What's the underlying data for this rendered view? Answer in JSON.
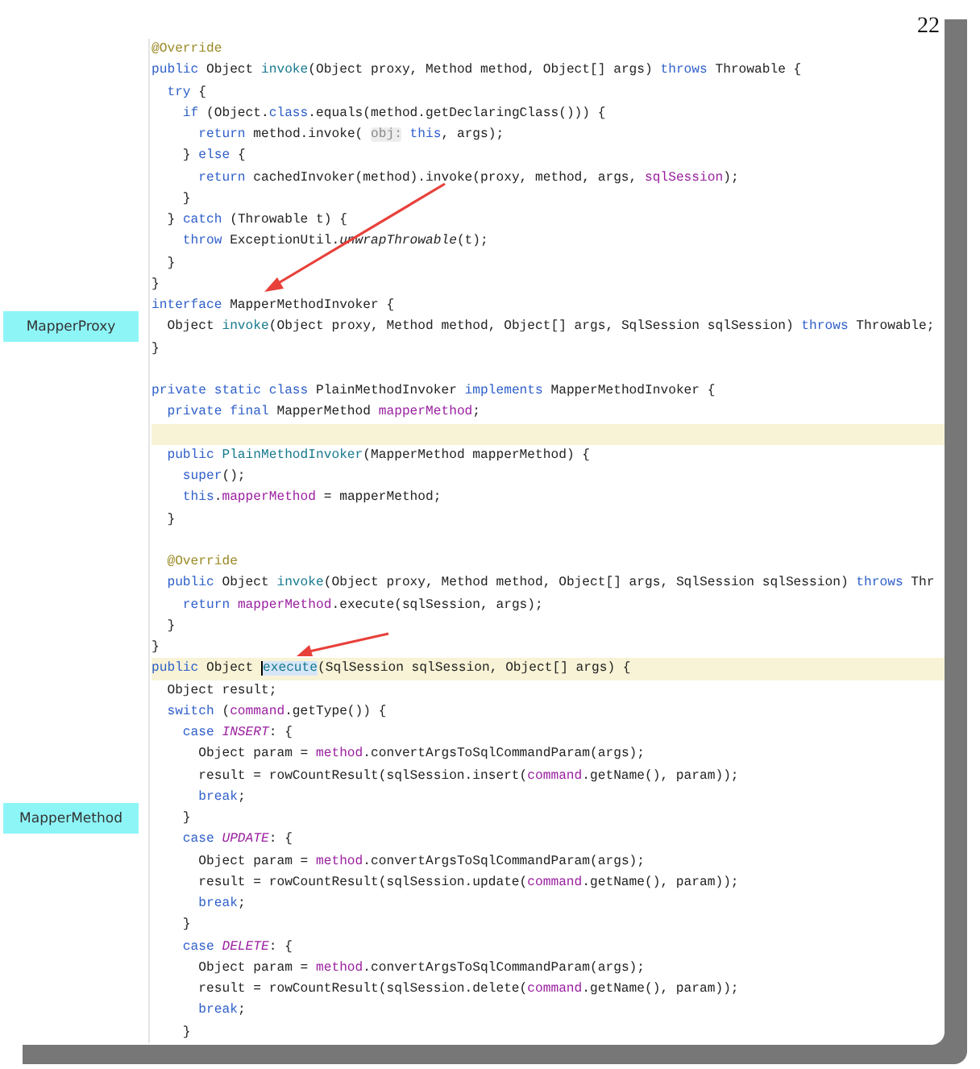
{
  "page_number": "22",
  "lines": [
    {
      "highlighted": false,
      "tokens": [
        {
          "kind": "ann",
          "text": "@Override"
        }
      ]
    },
    {
      "highlighted": false,
      "tokens": [
        {
          "kind": "kw",
          "text": "public "
        },
        {
          "kind": "pl",
          "text": "Object "
        },
        {
          "kind": "fn",
          "text": "invoke"
        },
        {
          "kind": "pl",
          "text": "(Object proxy, Method method, Object[] args) "
        },
        {
          "kind": "kw",
          "text": "throws "
        },
        {
          "kind": "pl",
          "text": "Throwable {"
        }
      ]
    },
    {
      "highlighted": false,
      "tokens": [
        {
          "kind": "kw",
          "text": "  try "
        },
        {
          "kind": "pl",
          "text": "{"
        }
      ]
    },
    {
      "highlighted": false,
      "tokens": [
        {
          "kind": "kw",
          "text": "    if "
        },
        {
          "kind": "pl",
          "text": "(Object."
        },
        {
          "kind": "kw",
          "text": "class"
        },
        {
          "kind": "pl",
          "text": ".equals(method.getDeclaringClass())) {"
        }
      ]
    },
    {
      "highlighted": false,
      "tokens": [
        {
          "kind": "kw",
          "text": "      return "
        },
        {
          "kind": "pl",
          "text": "method.invoke( "
        },
        {
          "kind": "hint",
          "text": "obj:"
        },
        {
          "kind": "kw",
          "text": " this"
        },
        {
          "kind": "pl",
          "text": ", args);"
        }
      ]
    },
    {
      "highlighted": false,
      "tokens": [
        {
          "kind": "pl",
          "text": "    } "
        },
        {
          "kind": "kw",
          "text": "else "
        },
        {
          "kind": "pl",
          "text": "{"
        }
      ]
    },
    {
      "highlighted": false,
      "tokens": [
        {
          "kind": "kw",
          "text": "      return "
        },
        {
          "kind": "pl",
          "text": "cachedInvoker(method).invoke(proxy, method, args, "
        },
        {
          "kind": "field",
          "text": "sqlSession"
        },
        {
          "kind": "pl",
          "text": ");"
        }
      ]
    },
    {
      "highlighted": false,
      "tokens": [
        {
          "kind": "pl",
          "text": "    }"
        }
      ]
    },
    {
      "highlighted": false,
      "tokens": [
        {
          "kind": "pl",
          "text": "  } "
        },
        {
          "kind": "kw",
          "text": "catch "
        },
        {
          "kind": "pl",
          "text": "(Throwable t) {"
        }
      ]
    },
    {
      "highlighted": false,
      "tokens": [
        {
          "kind": "kw",
          "text": "    throw "
        },
        {
          "kind": "pl",
          "text": "ExceptionUtil."
        },
        {
          "kind": "it",
          "text": "unwrapThrowable"
        },
        {
          "kind": "pl",
          "text": "(t);"
        }
      ]
    },
    {
      "highlighted": false,
      "tokens": [
        {
          "kind": "pl",
          "text": "  }"
        }
      ]
    },
    {
      "highlighted": false,
      "tokens": [
        {
          "kind": "pl",
          "text": "}"
        }
      ]
    },
    {
      "highlighted": false,
      "tokens": [
        {
          "kind": "kw",
          "text": "interface "
        },
        {
          "kind": "pl",
          "text": "MapperMethodInvoker {"
        }
      ]
    },
    {
      "highlighted": false,
      "side_label": "MapperProxy",
      "tokens": [
        {
          "kind": "pl",
          "text": "  Object "
        },
        {
          "kind": "fn",
          "text": "invoke"
        },
        {
          "kind": "pl",
          "text": "(Object proxy, Method method, Object[] args, SqlSession sqlSession) "
        },
        {
          "kind": "kw",
          "text": "throws "
        },
        {
          "kind": "pl",
          "text": "Throwable;"
        }
      ]
    },
    {
      "highlighted": false,
      "tokens": [
        {
          "kind": "pl",
          "text": "}"
        }
      ]
    },
    {
      "highlighted": false
    },
    {
      "highlighted": false,
      "tokens": [
        {
          "kind": "kw",
          "text": "private static class "
        },
        {
          "kind": "pl",
          "text": "PlainMethodInvoker "
        },
        {
          "kind": "kw",
          "text": "implements "
        },
        {
          "kind": "pl",
          "text": "MapperMethodInvoker {"
        }
      ]
    },
    {
      "highlighted": false,
      "tokens": [
        {
          "kind": "kw",
          "text": "  private final "
        },
        {
          "kind": "pl",
          "text": "MapperMethod "
        },
        {
          "kind": "field",
          "text": "mapperMethod"
        },
        {
          "kind": "pl",
          "text": ";"
        }
      ]
    },
    {
      "highlighted": true
    },
    {
      "highlighted": false,
      "tokens": [
        {
          "kind": "kw",
          "text": "  public "
        },
        {
          "kind": "fn",
          "text": "PlainMethodInvoker"
        },
        {
          "kind": "pl",
          "text": "(MapperMethod mapperMethod) {"
        }
      ]
    },
    {
      "highlighted": false,
      "tokens": [
        {
          "kind": "kw",
          "text": "    super"
        },
        {
          "kind": "pl",
          "text": "();"
        }
      ]
    },
    {
      "highlighted": false,
      "tokens": [
        {
          "kind": "kw",
          "text": "    this"
        },
        {
          "kind": "pl",
          "text": "."
        },
        {
          "kind": "field",
          "text": "mapperMethod"
        },
        {
          "kind": "pl",
          "text": " = mapperMethod;"
        }
      ]
    },
    {
      "highlighted": false,
      "tokens": [
        {
          "kind": "pl",
          "text": "  }"
        }
      ]
    },
    {
      "highlighted": false
    },
    {
      "highlighted": false,
      "tokens": [
        {
          "kind": "ann",
          "text": "  @Override"
        }
      ]
    },
    {
      "highlighted": false,
      "tokens": [
        {
          "kind": "kw",
          "text": "  public "
        },
        {
          "kind": "pl",
          "text": "Object "
        },
        {
          "kind": "fn",
          "text": "invoke"
        },
        {
          "kind": "pl",
          "text": "(Object proxy, Method method, Object[] args, SqlSession sqlSession) "
        },
        {
          "kind": "kw",
          "text": "throws "
        },
        {
          "kind": "pl",
          "text": "Thr"
        }
      ]
    },
    {
      "highlighted": false,
      "tokens": [
        {
          "kind": "kw",
          "text": "    return "
        },
        {
          "kind": "field",
          "text": "mapperMethod"
        },
        {
          "kind": "pl",
          "text": ".execute(sqlSession, args);"
        }
      ]
    },
    {
      "highlighted": false,
      "tokens": [
        {
          "kind": "pl",
          "text": "  }"
        }
      ]
    },
    {
      "highlighted": false,
      "tokens": [
        {
          "kind": "pl",
          "text": "}"
        }
      ]
    },
    {
      "highlighted": true,
      "tokens": [
        {
          "kind": "kw",
          "text": "public "
        },
        {
          "kind": "pl",
          "text": "Object "
        },
        {
          "kind": "sel",
          "text": "execute"
        },
        {
          "kind": "pl",
          "text": "(SqlSession sqlSession, Object[] args) {"
        }
      ]
    },
    {
      "highlighted": false,
      "tokens": [
        {
          "kind": "pl",
          "text": "  Object result;"
        }
      ]
    },
    {
      "highlighted": false,
      "tokens": [
        {
          "kind": "kw",
          "text": "  switch "
        },
        {
          "kind": "pl",
          "text": "("
        },
        {
          "kind": "field",
          "text": "command"
        },
        {
          "kind": "pl",
          "text": ".getType()) {"
        }
      ]
    },
    {
      "highlighted": false,
      "tokens": [
        {
          "kind": "kw",
          "text": "    case "
        },
        {
          "kind": "const",
          "text": "INSERT"
        },
        {
          "kind": "pl",
          "text": ": {"
        }
      ]
    },
    {
      "highlighted": false,
      "tokens": [
        {
          "kind": "pl",
          "text": "      Object param = "
        },
        {
          "kind": "field",
          "text": "method"
        },
        {
          "kind": "pl",
          "text": ".convertArgsToSqlCommandParam(args);"
        }
      ]
    },
    {
      "highlighted": false,
      "tokens": [
        {
          "kind": "pl",
          "text": "      result = rowCountResult(sqlSession.insert("
        },
        {
          "kind": "field",
          "text": "command"
        },
        {
          "kind": "pl",
          "text": ".getName(), param));"
        }
      ]
    },
    {
      "highlighted": false,
      "tokens": [
        {
          "kind": "kw",
          "text": "      break"
        },
        {
          "kind": "pl",
          "text": ";"
        }
      ]
    },
    {
      "highlighted": false,
      "side_label": "MapperMethod",
      "tokens": [
        {
          "kind": "pl",
          "text": "    }"
        }
      ]
    },
    {
      "highlighted": false,
      "tokens": [
        {
          "kind": "kw",
          "text": "    case "
        },
        {
          "kind": "const",
          "text": "UPDATE"
        },
        {
          "kind": "pl",
          "text": ": {"
        }
      ]
    },
    {
      "highlighted": false,
      "tokens": [
        {
          "kind": "pl",
          "text": "      Object param = "
        },
        {
          "kind": "field",
          "text": "method"
        },
        {
          "kind": "pl",
          "text": ".convertArgsToSqlCommandParam(args);"
        }
      ]
    },
    {
      "highlighted": false,
      "tokens": [
        {
          "kind": "pl",
          "text": "      result = rowCountResult(sqlSession.update("
        },
        {
          "kind": "field",
          "text": "command"
        },
        {
          "kind": "pl",
          "text": ".getName(), param));"
        }
      ]
    },
    {
      "highlighted": false,
      "tokens": [
        {
          "kind": "kw",
          "text": "      break"
        },
        {
          "kind": "pl",
          "text": ";"
        }
      ]
    },
    {
      "highlighted": false,
      "tokens": [
        {
          "kind": "pl",
          "text": "    }"
        }
      ]
    },
    {
      "highlighted": false,
      "tokens": [
        {
          "kind": "kw",
          "text": "    case "
        },
        {
          "kind": "const",
          "text": "DELETE"
        },
        {
          "kind": "pl",
          "text": ": {"
        }
      ]
    },
    {
      "highlighted": false,
      "tokens": [
        {
          "kind": "pl",
          "text": "      Object param = "
        },
        {
          "kind": "field",
          "text": "method"
        },
        {
          "kind": "pl",
          "text": ".convertArgsToSqlCommandParam(args);"
        }
      ]
    },
    {
      "highlighted": false,
      "tokens": [
        {
          "kind": "pl",
          "text": "      result = rowCountResult(sqlSession.delete("
        },
        {
          "kind": "field",
          "text": "command"
        },
        {
          "kind": "pl",
          "text": ".getName(), param));"
        }
      ]
    },
    {
      "highlighted": false,
      "tokens": [
        {
          "kind": "kw",
          "text": "      break"
        },
        {
          "kind": "pl",
          "text": ";"
        }
      ]
    },
    {
      "highlighted": false,
      "tokens": [
        {
          "kind": "pl",
          "text": "    }"
        }
      ]
    }
  ]
}
